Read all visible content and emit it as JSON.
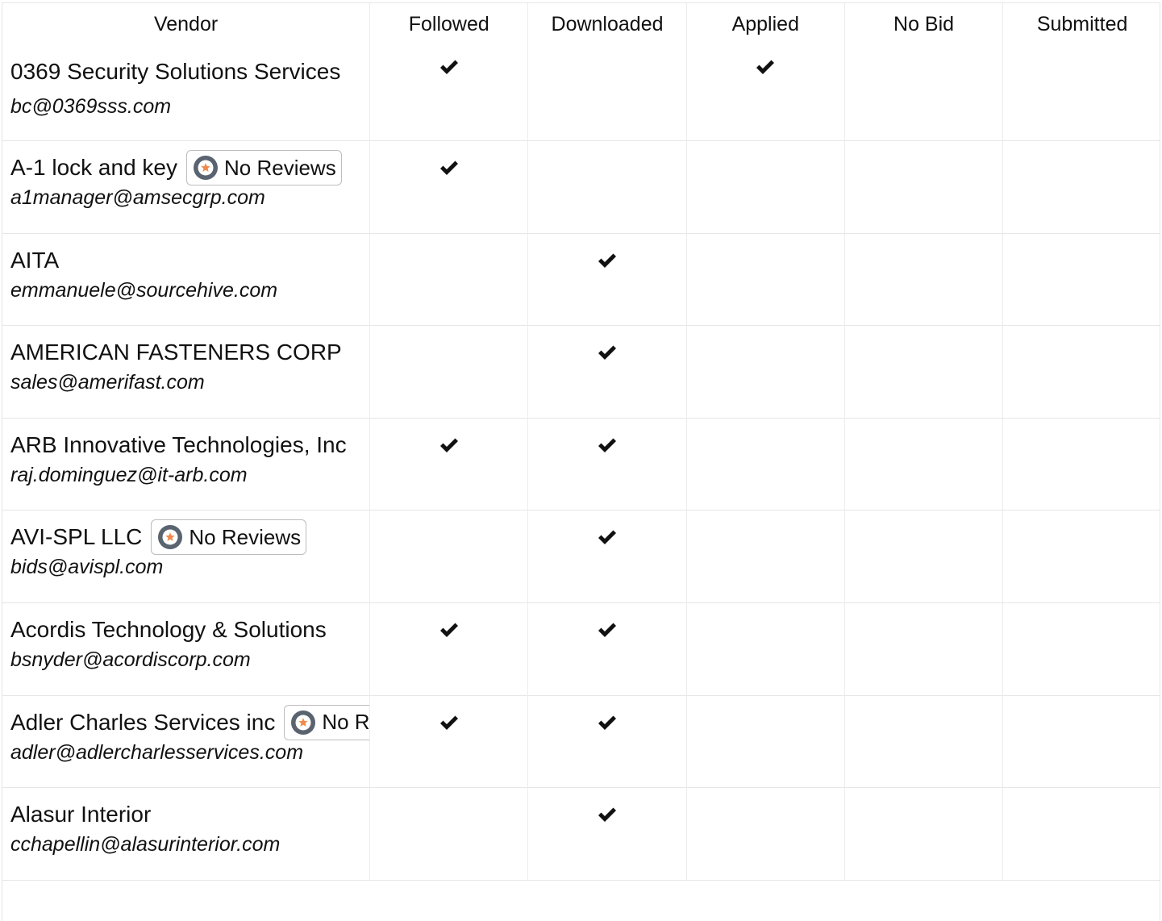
{
  "table": {
    "columns": [
      "Vendor",
      "Followed",
      "Downloaded",
      "Applied",
      "No Bid",
      "Submitted"
    ],
    "review_badge_label": "No Reviews",
    "rows": [
      {
        "name": "0369 Security Solutions Services",
        "email": "bc@0369sss.com",
        "badge": false,
        "followed": true,
        "downloaded": false,
        "applied": true,
        "no_bid": false,
        "submitted": false
      },
      {
        "name": "A-1 lock and key",
        "email": "a1manager@amsecgrp.com",
        "badge": true,
        "followed": true,
        "downloaded": false,
        "applied": false,
        "no_bid": false,
        "submitted": false
      },
      {
        "name": "AITA",
        "email": "emmanuele@sourcehive.com",
        "badge": false,
        "followed": false,
        "downloaded": true,
        "applied": false,
        "no_bid": false,
        "submitted": false
      },
      {
        "name": "AMERICAN FASTENERS CORP",
        "email": "sales@amerifast.com",
        "badge": false,
        "followed": false,
        "downloaded": true,
        "applied": false,
        "no_bid": false,
        "submitted": false
      },
      {
        "name": "ARB Innovative Technologies, Inc",
        "email": "raj.dominguez@it-arb.com",
        "badge": false,
        "followed": true,
        "downloaded": true,
        "applied": false,
        "no_bid": false,
        "submitted": false
      },
      {
        "name": "AVI-SPL LLC",
        "email": "bids@avispl.com",
        "badge": true,
        "followed": false,
        "downloaded": true,
        "applied": false,
        "no_bid": false,
        "submitted": false
      },
      {
        "name": "Acordis Technology & Solutions",
        "email": "bsnyder@acordiscorp.com",
        "badge": false,
        "followed": true,
        "downloaded": true,
        "applied": false,
        "no_bid": false,
        "submitted": false
      },
      {
        "name": "Adler Charles Services inc",
        "email": "adler@adlercharlesservices.com",
        "badge": true,
        "followed": true,
        "downloaded": true,
        "applied": false,
        "no_bid": false,
        "submitted": false
      },
      {
        "name": "Alasur Interior",
        "email": "cchapellin@alasurinterior.com",
        "badge": false,
        "followed": false,
        "downloaded": true,
        "applied": false,
        "no_bid": false,
        "submitted": false
      }
    ]
  },
  "icons": {
    "check": "checkmark-icon",
    "badge": "review-star-icon"
  },
  "colors": {
    "badge_icon_ring": "#5a6370",
    "badge_icon_star": "#f08a4b",
    "border": "#e6e6e6"
  }
}
